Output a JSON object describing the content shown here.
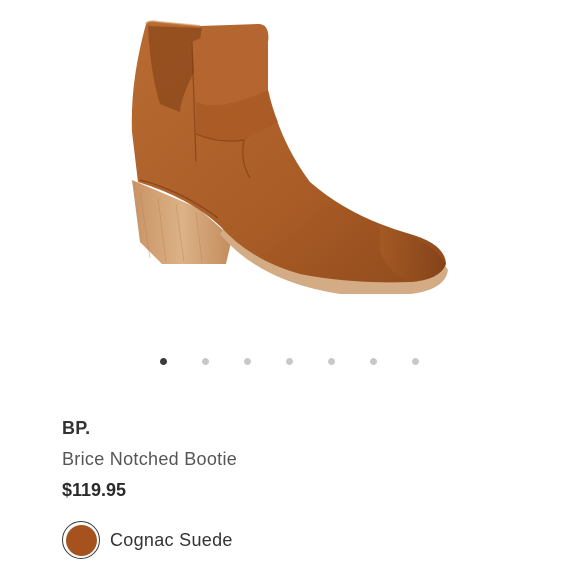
{
  "product": {
    "image_alt": "Brice Notched Bootie in Cognac Suede",
    "brand": "BP.",
    "name": "Brice Notched Bootie",
    "price": "$119.95",
    "selected_color": {
      "name": "Cognac Suede",
      "hex": "#a5521f"
    }
  },
  "carousel": {
    "total_images": 7,
    "active_index": 0
  },
  "colors": {
    "suede": "#b0642c",
    "suede_dark": "#8e4a1c",
    "suede_light": "#c27a40",
    "heel_wood": "#d2a678",
    "sole": "#c9a07a",
    "dot_active": "#3a3a3a",
    "dot_inactive": "#c8c8c8"
  }
}
